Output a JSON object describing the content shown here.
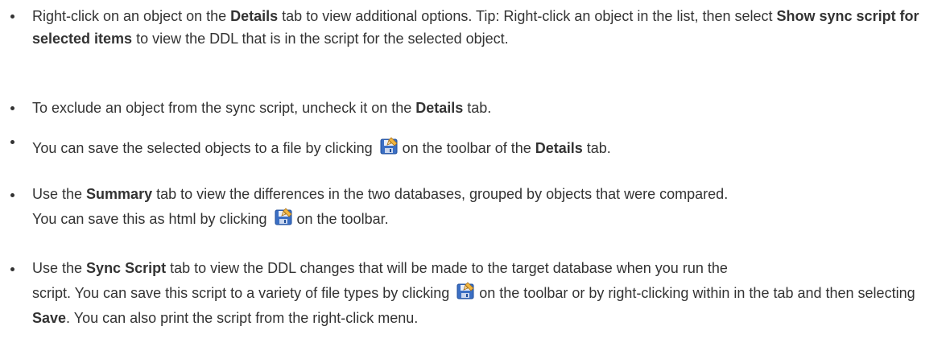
{
  "bullets": [
    {
      "part1": "Right-click on an object on the ",
      "b1": "Details",
      "part2": " tab to view additional options. Tip: Right-click an object in the list, then select ",
      "b2": "Show sync script for selected items",
      "part3": " to view the DDL that is in the script for the selected object."
    },
    {
      "part1": "To exclude an object from the sync script, uncheck it on the ",
      "b1": "Details",
      "part2": " tab."
    },
    {
      "part1": "You can save the selected objects to a file by clicking",
      "part2": "on the toolbar of the ",
      "b1": "Details",
      "part3": " tab.",
      "icon": "save-icon"
    },
    {
      "part1": "Use the ",
      "b1": "Summary",
      "part2": " tab to view the differences in the two databases, grouped by objects that were compared.",
      "part3": "You can save this as html by clicking",
      "part4": "on the toolbar.",
      "icon": "save-icon"
    },
    {
      "part1": "Use the ",
      "b1": "Sync Script",
      "part2": " tab to view the DDL changes that will be made to the target database when you run the",
      "part3": "script. You can save this script to a variety of file types by clicking",
      "part4": "on the toolbar or by right-clicking within in the tab and then selecting ",
      "b2": "Save",
      "part5": ". You can also print the script from the right-click menu.",
      "icon": "save-icon"
    }
  ]
}
